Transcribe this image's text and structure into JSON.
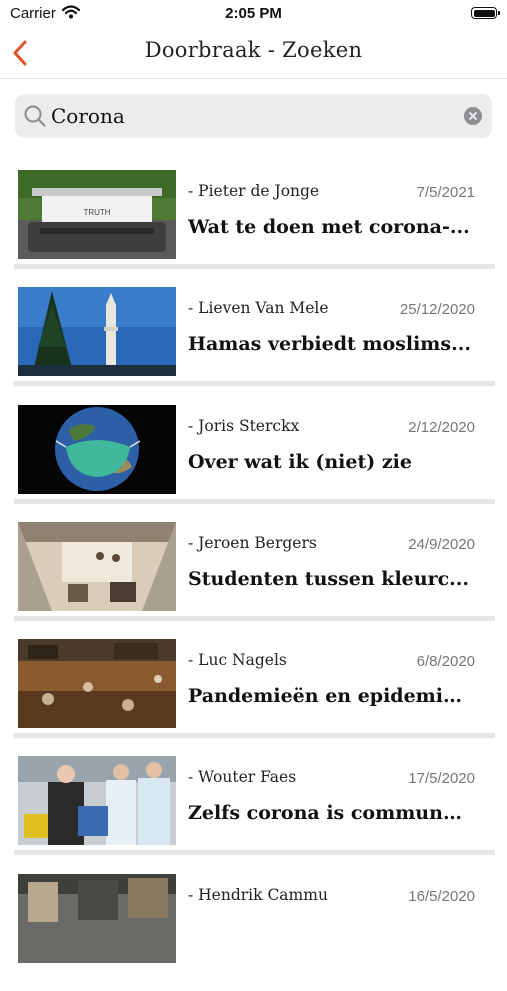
{
  "status_bar": {
    "carrier": "Carrier",
    "time": "2:05 PM"
  },
  "nav": {
    "title": "Doorbraak - Zoeken"
  },
  "search": {
    "value": "Corona"
  },
  "articles": [
    {
      "author": "- Pieter de Jonge",
      "date": "7/5/2021",
      "title": "Wat te doen met corona-..."
    },
    {
      "author": "- Lieven Van Mele",
      "date": "25/12/2020",
      "title": "Hamas verbiedt moslims..."
    },
    {
      "author": "- Joris Sterckx",
      "date": "2/12/2020",
      "title": "Over wat ik (niet) zie"
    },
    {
      "author": "- Jeroen Bergers",
      "date": "24/9/2020",
      "title": "Studenten tussen kleurc..."
    },
    {
      "author": "- Luc Nagels",
      "date": "6/8/2020",
      "title": "Pandemieën en epidemie..."
    },
    {
      "author": "- Wouter Faes",
      "date": "17/5/2020",
      "title": "Zelfs corona is communa..."
    },
    {
      "author": "- Hendrik Cammu",
      "date": "16/5/2020",
      "title": ""
    }
  ],
  "thumbnails": {
    "0": {
      "text": "TRUTH"
    }
  }
}
